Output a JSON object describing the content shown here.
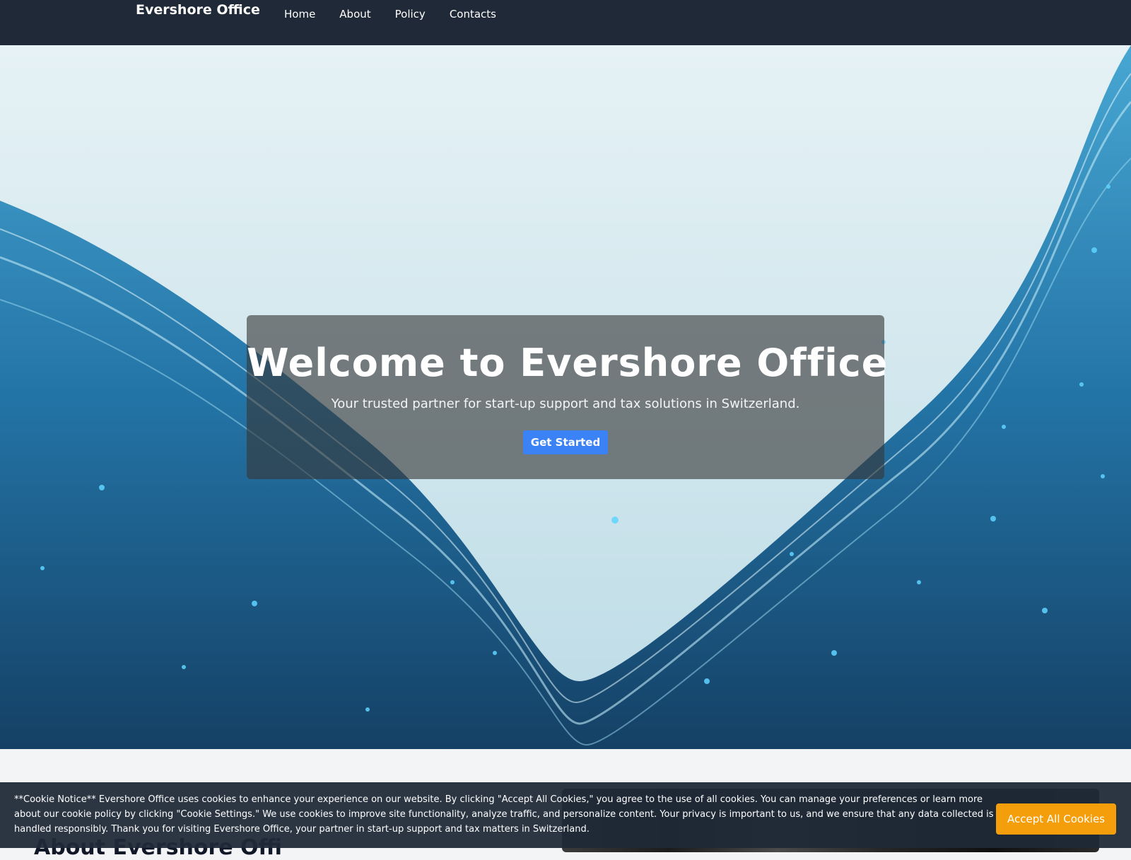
{
  "navbar": {
    "brand": "Evershore Office",
    "links": [
      {
        "label": "Home"
      },
      {
        "label": "About"
      },
      {
        "label": "Policy"
      },
      {
        "label": "Contacts"
      }
    ]
  },
  "hero": {
    "title": "Welcome to Evershore Office",
    "subtitle": "Your trusted partner for start-up support and tax solutions in Switzerland.",
    "button_label": "Get Started"
  },
  "about": {
    "heading": "About Evershore Offi"
  },
  "cookie": {
    "text": "**Cookie Notice** Evershore Office uses cookies to enhance your experience on our website. By clicking \"Accept All Cookies,\" you agree to the use of all cookies. You can manage your preferences or learn more about our cookie policy by clicking \"Cookie Settings.\" We use cookies to improve site functionality, analyze traffic, and personalize content. Your privacy is important to us, and we ensure that any data collected is handled responsibly. Thank you for visiting Evershore Office, your partner in start-up support and tax matters in Switzerland.",
    "button_label": "Accept All Cookies"
  },
  "colors": {
    "navbar_bg": "#1f2937",
    "primary_button": "#3b82f6",
    "cookie_button": "#f59e0b",
    "page_bg": "#f3f4f6"
  }
}
